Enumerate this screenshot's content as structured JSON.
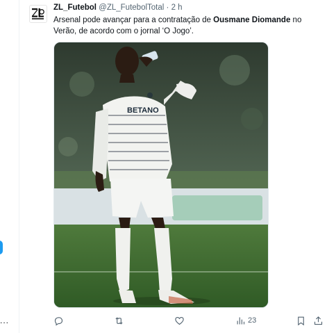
{
  "tweet": {
    "display_name": "ZL_Futebol",
    "handle": "@ZL_FutebolTotal",
    "separator": "·",
    "time": "2 h",
    "text_part1": "Arsenal pode avançar para a contratação de ",
    "text_bold": "Ousmane Diomande",
    "text_part2": " no Verão, de acordo com o jornal ‘O Jogo’.",
    "image": {
      "shirt_sponsor": "BETANO"
    },
    "actions": {
      "views_count": "23"
    }
  },
  "left_edge": {
    "dots": "..."
  },
  "icons": {
    "reply": "reply-icon",
    "retweet": "retweet-icon",
    "like": "like-icon",
    "views": "views-icon",
    "bookmark": "bookmark-icon",
    "share": "share-icon"
  },
  "colors": {
    "accent": "#1d9bf0",
    "secondary_text": "#536471",
    "border": "#eff3f4"
  }
}
